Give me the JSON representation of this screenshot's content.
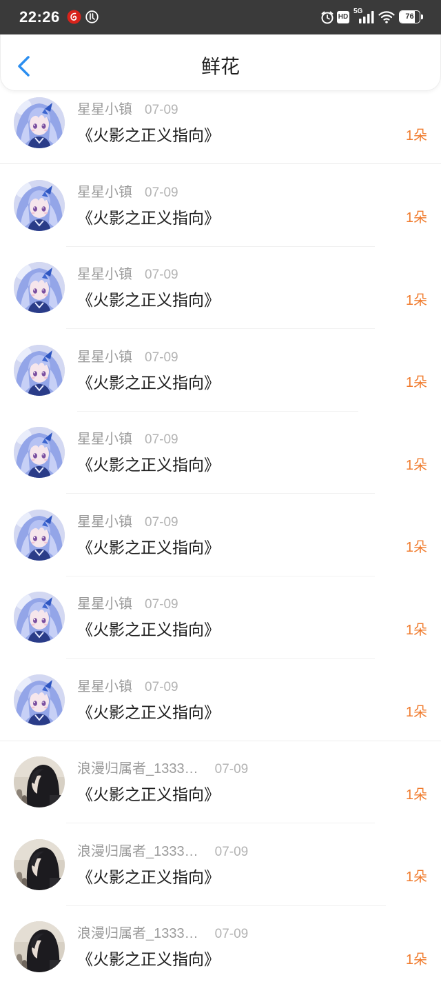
{
  "status_bar": {
    "time": "22:26",
    "left_icons": [
      "netease-music-icon",
      "circle-app-icon"
    ],
    "right_icons": [
      "alarm-icon",
      "hd-icon",
      "signal-5g-icon",
      "wifi-icon",
      "battery-icon"
    ],
    "hd_label": "HD",
    "network_label": "5G",
    "battery_level": "76"
  },
  "header": {
    "back_icon": "chevron-left-icon",
    "title": "鲜花"
  },
  "colors": {
    "status_bar_bg": "#3a3a3a",
    "accent": "#2b8ef0",
    "count": "#f07b2d"
  },
  "items": [
    {
      "avatar": "anime-girl-avatar",
      "user": "星星小镇",
      "date": "07-09",
      "title": "《火影之正义指向》",
      "count": "1朵"
    },
    {
      "avatar": "anime-girl-avatar",
      "user": "星星小镇",
      "date": "07-09",
      "title": "《火影之正义指向》",
      "count": "1朵"
    },
    {
      "avatar": "anime-girl-avatar",
      "user": "星星小镇",
      "date": "07-09",
      "title": "《火影之正义指向》",
      "count": "1朵"
    },
    {
      "avatar": "anime-girl-avatar",
      "user": "星星小镇",
      "date": "07-09",
      "title": "《火影之正义指向》",
      "count": "1朵"
    },
    {
      "avatar": "anime-girl-avatar",
      "user": "星星小镇",
      "date": "07-09",
      "title": "《火影之正义指向》",
      "count": "1朵"
    },
    {
      "avatar": "anime-girl-avatar",
      "user": "星星小镇",
      "date": "07-09",
      "title": "《火影之正义指向》",
      "count": "1朵"
    },
    {
      "avatar": "anime-girl-avatar",
      "user": "星星小镇",
      "date": "07-09",
      "title": "《火影之正义指向》",
      "count": "1朵"
    },
    {
      "avatar": "anime-girl-avatar",
      "user": "星星小镇",
      "date": "07-09",
      "title": "《火影之正义指向》",
      "count": "1朵"
    },
    {
      "avatar": "dark-hair-girl-avatar",
      "user": "浪漫归属者_1333…",
      "date": "07-09",
      "title": "《火影之正义指向》",
      "count": "1朵"
    },
    {
      "avatar": "dark-hair-girl-avatar",
      "user": "浪漫归属者_1333…",
      "date": "07-09",
      "title": "《火影之正义指向》",
      "count": "1朵"
    },
    {
      "avatar": "dark-hair-girl-avatar",
      "user": "浪漫归属者_1333…",
      "date": "07-09",
      "title": "《火影之正义指向》",
      "count": "1朵"
    }
  ]
}
